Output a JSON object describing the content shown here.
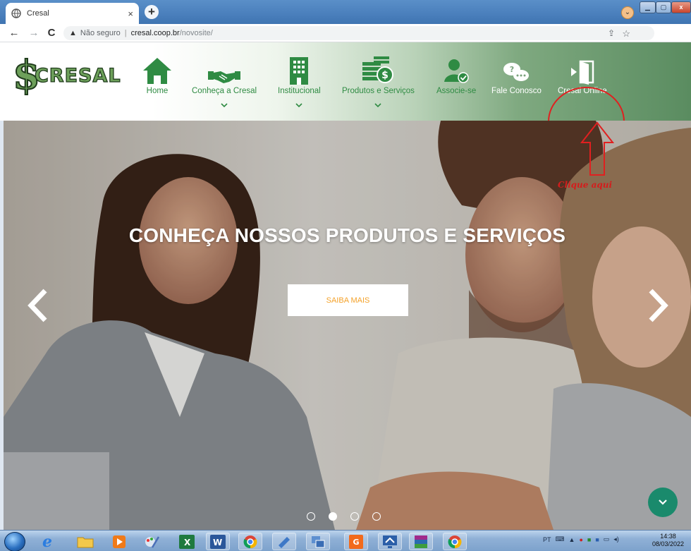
{
  "browser": {
    "tab_title": "Cresal",
    "tab_close": "×",
    "new_tab": "+",
    "security_label": "Não seguro",
    "url_host": "cresal.coop.br",
    "url_path": "/novosite/"
  },
  "site": {
    "logo_text": "CRESAL",
    "nav": [
      {
        "label": "Home",
        "icon": "home-icon"
      },
      {
        "label": "Conheça a Cresal",
        "icon": "handshake-icon"
      },
      {
        "label": "Institucional",
        "icon": "building-icon"
      },
      {
        "label": "Produtos e Serviços",
        "icon": "money-stack-icon"
      },
      {
        "label": "Associe-se",
        "icon": "user-check-icon"
      },
      {
        "label": "Fale Conosco",
        "icon": "chat-bubbles-icon"
      },
      {
        "label": "Cresal Online",
        "icon": "door-exit-icon"
      }
    ],
    "annotation": "Clique aqui",
    "colors": {
      "brand_green": "#2f8b43",
      "accent_orange": "#f4a22a",
      "annotation_red": "#e02020"
    }
  },
  "hero": {
    "title": "CONHEÇA NOSSOS PRODUTOS E SERVIÇOS",
    "button_label": "SAIBA MAIS",
    "slide_count": 4,
    "active_slide": 2
  },
  "taskbar": {
    "language": "PT",
    "time": "14:38",
    "date": "08/03/2022",
    "apps": [
      "ie",
      "explorer",
      "media-player",
      "paint",
      "excel",
      "word",
      "chrome-c",
      "notepad",
      "network",
      "pdf",
      "monitor",
      "winrar",
      "chrome"
    ]
  }
}
